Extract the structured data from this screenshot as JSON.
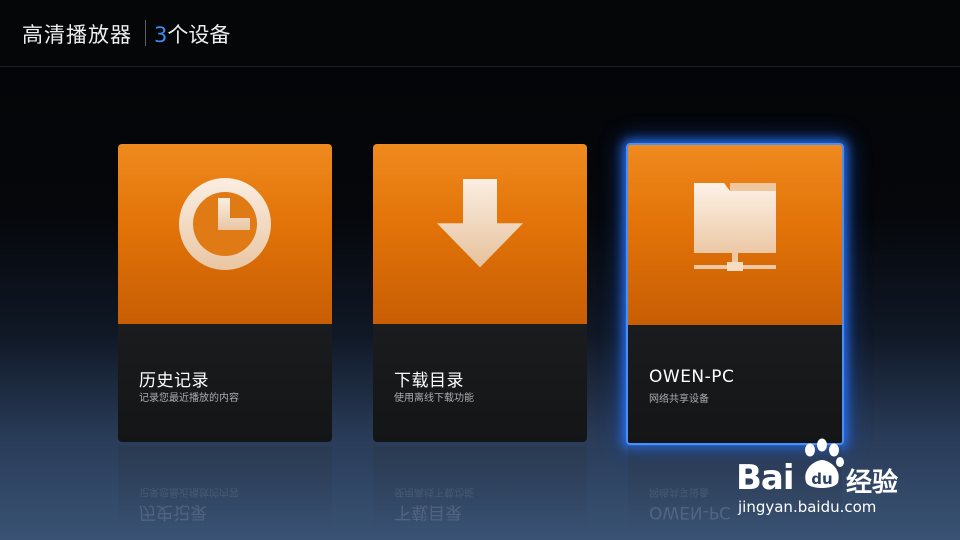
{
  "header": {
    "app_title": "高清播放器",
    "device_count_number": "3",
    "device_count_suffix": "个设备"
  },
  "cards": [
    {
      "label": "历史记录",
      "subtitle": "记录您最近播放的内容",
      "icon": "clock-icon",
      "focused": false
    },
    {
      "label": "下载目录",
      "subtitle": "使用离线下载功能",
      "icon": "download-arrow-icon",
      "focused": false
    },
    {
      "label": "OWEN-PC",
      "subtitle": "网络共享设备",
      "icon": "network-folder-icon",
      "focused": true
    }
  ],
  "watermark": {
    "brand": "Bai",
    "brand_du": "du",
    "brand_suffix": "经验",
    "url": "jingyan.baidu.com"
  },
  "colors": {
    "accent_orange": "#e27308",
    "focus_blue": "#4a8ff5",
    "count_blue": "#3a8ff0"
  }
}
